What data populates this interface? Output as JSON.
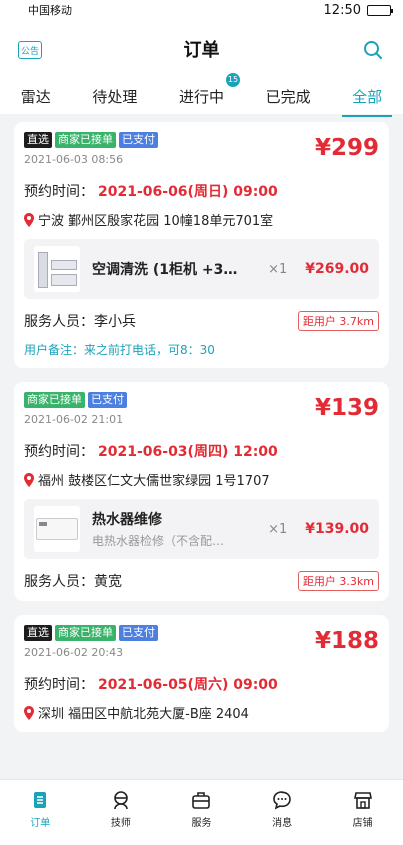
{
  "status_bar": {
    "carrier": "中国移动",
    "time": "12:50"
  },
  "header": {
    "title": "订单",
    "left_badge": "公告"
  },
  "tabs": [
    {
      "label": "雷达"
    },
    {
      "label": "待处理"
    },
    {
      "label": "进行中",
      "count": "15"
    },
    {
      "label": "已完成"
    },
    {
      "label": "全部"
    }
  ],
  "orders": [
    {
      "tags": [
        "直选",
        "商家已接单",
        "已支付"
      ],
      "date": "2021-06-03 08:56",
      "price": "¥299",
      "appt_label": "预约时间：",
      "appt_time": "2021-06-06(周日) 09:00",
      "address": "宁波 鄞州区殷家花园 10幢18单元701室",
      "item_name": "空调清洗 (1柜机 +3…",
      "item_qty": "×1",
      "item_price": "¥269.00",
      "staff_label": "服务人员：",
      "staff_name": "李小兵",
      "distance": "距用户  3.7km",
      "note": "用户备注：来之前打电话，可8：30"
    },
    {
      "tags": [
        "商家已接单",
        "已支付"
      ],
      "date": "2021-06-02 21:01",
      "price": "¥139",
      "appt_label": "预约时间：",
      "appt_time": "2021-06-03(周四) 12:00",
      "address": "福州 鼓楼区仁文大儒世家绿园 1号1707",
      "item_name": "热水器维修",
      "item_sub": "电热水器检修（不含配…",
      "item_qty": "×1",
      "item_price": "¥139.00",
      "staff_label": "服务人员：",
      "staff_name": "黄宽",
      "distance": "距用户  3.3km"
    },
    {
      "tags": [
        "直选",
        "商家已接单",
        "已支付"
      ],
      "date": "2021-06-02 20:43",
      "price": "¥188",
      "appt_label": "预约时间：",
      "appt_time": "2021-06-05(周六) 09:00",
      "address": "深圳 福田区中航北苑大厦-B座 2404"
    }
  ],
  "tabbar": [
    {
      "label": "订单",
      "icon": "order-icon"
    },
    {
      "label": "技师",
      "icon": "technician-icon"
    },
    {
      "label": "服务",
      "icon": "service-icon"
    },
    {
      "label": "消息",
      "icon": "message-icon"
    },
    {
      "label": "店铺",
      "icon": "store-icon"
    }
  ],
  "colors": {
    "accent": "#1aa3b8",
    "price": "#e22b35",
    "green_tag": "#39b36a",
    "blue_tag": "#4d7fe0"
  }
}
